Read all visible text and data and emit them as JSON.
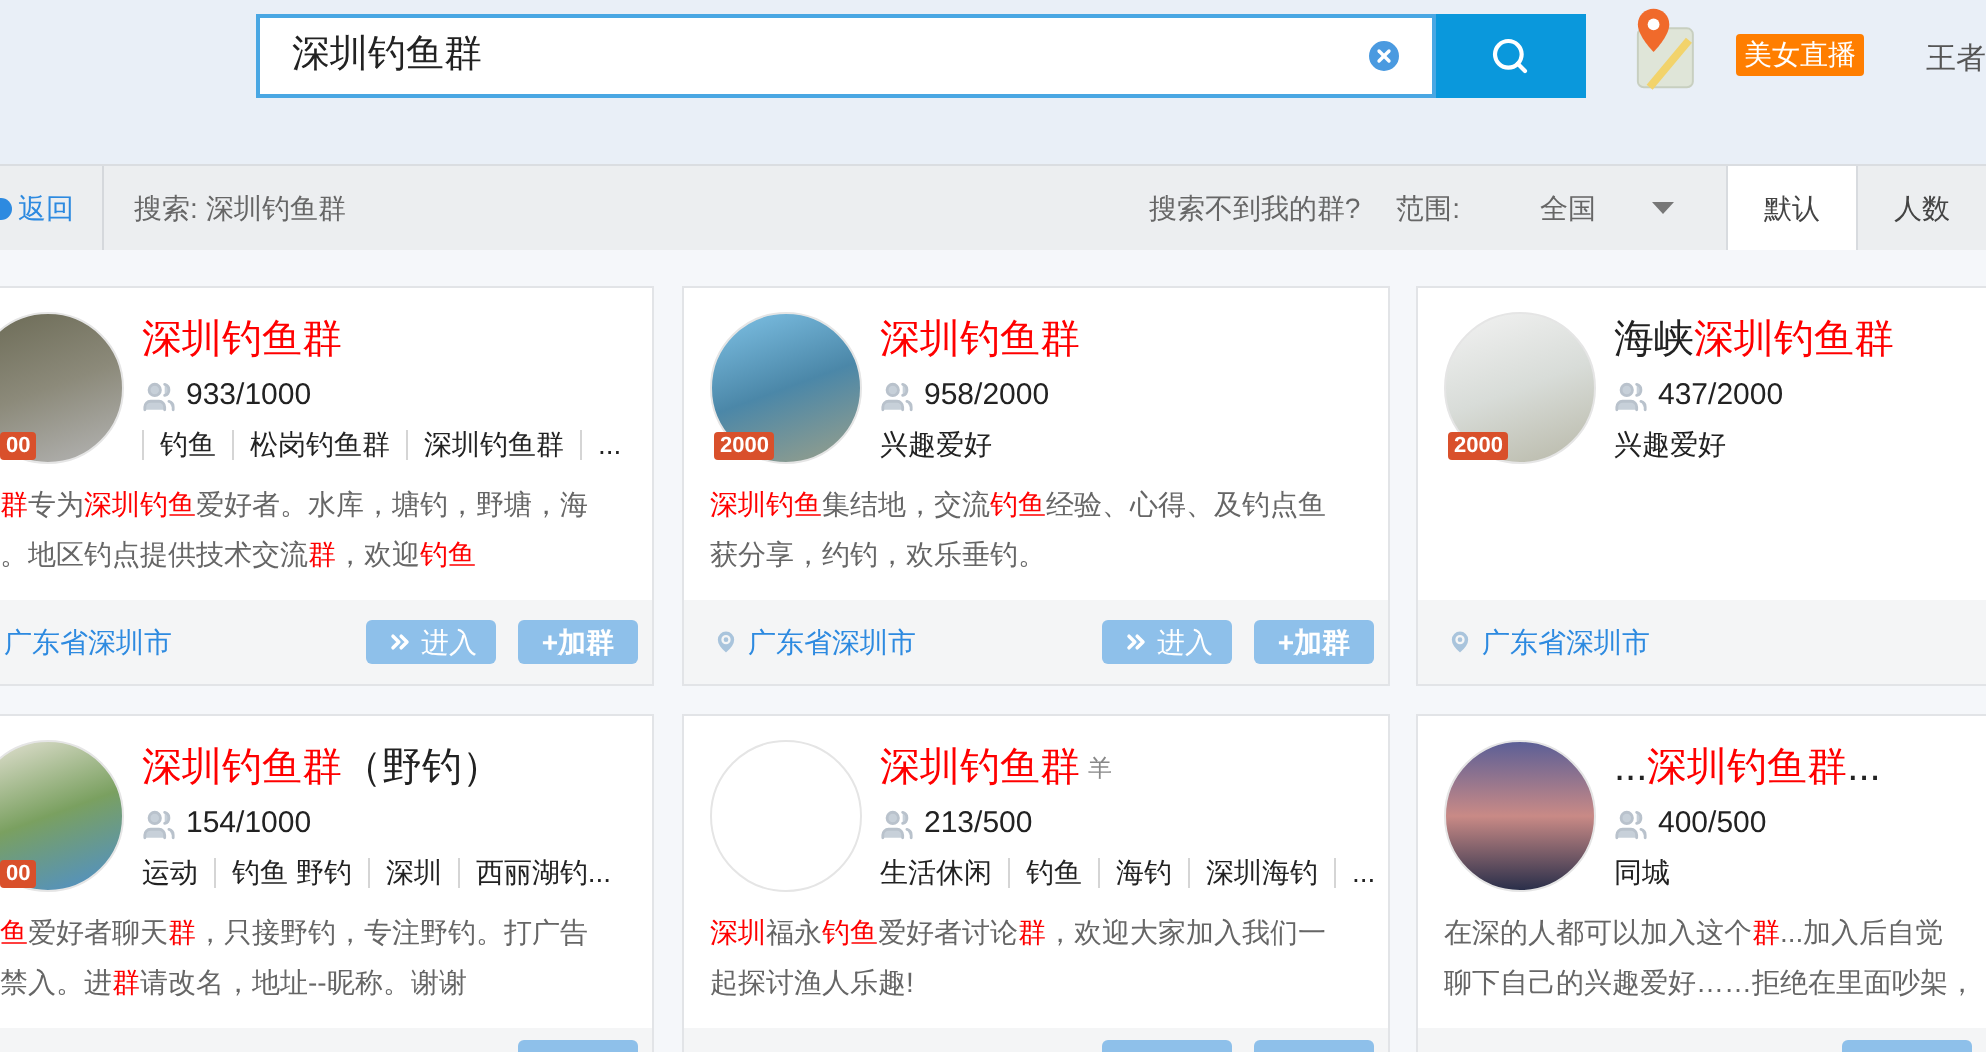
{
  "search": {
    "value": "深圳钓鱼群"
  },
  "header": {
    "live_badge": "美女直播",
    "user": "王者"
  },
  "toolbar": {
    "back": "返回",
    "query": "搜索: 深圳钓鱼群",
    "not_found": "搜索不到我的群?",
    "range_label": "范围:",
    "range_value": "全国",
    "sort_tabs": [
      {
        "label": "默认",
        "selected": true
      },
      {
        "label": "人数",
        "selected": false
      }
    ]
  },
  "cards": [
    {
      "title": [
        {
          "text": "深圳钓鱼群",
          "kind": "highlight"
        }
      ],
      "badge": "00",
      "members": "933/1000",
      "leading_divider": true,
      "tags": [
        "钓鱼",
        "松岗钓鱼群",
        "深圳钓鱼群",
        "..."
      ],
      "description": [
        [
          {
            "text": "群",
            "kind": "highlight"
          },
          {
            "text": "专为",
            "kind": "plain"
          },
          {
            "text": "深圳钓鱼",
            "kind": "highlight"
          },
          {
            "text": "爱好者。水库，塘钓，野塘，海",
            "kind": "plain"
          }
        ],
        [
          {
            "text": "。地区钓点提供技术交流",
            "kind": "plain"
          },
          {
            "text": "群",
            "kind": "highlight"
          },
          {
            "text": "，欢迎",
            "kind": "plain"
          },
          {
            "text": "钓鱼",
            "kind": "highlight"
          }
        ]
      ],
      "location": "广东省深圳市",
      "actions": [
        {
          "kind": "enter",
          "label": "进入"
        },
        {
          "kind": "join",
          "label": "+加群"
        }
      ]
    },
    {
      "title": [
        {
          "text": "深圳钓鱼群",
          "kind": "highlight"
        }
      ],
      "badge": "2000",
      "members": "958/2000",
      "tags": [
        "兴趣爱好"
      ],
      "description": [
        [
          {
            "text": "深圳钓鱼",
            "kind": "highlight"
          },
          {
            "text": "集结地，交流",
            "kind": "plain"
          },
          {
            "text": "钓鱼",
            "kind": "highlight"
          },
          {
            "text": "经验、心得、及钓点鱼",
            "kind": "plain"
          }
        ],
        [
          {
            "text": "获分享，约钓，欢乐垂钓。",
            "kind": "plain"
          }
        ]
      ],
      "location": "广东省深圳市",
      "actions": [
        {
          "kind": "enter",
          "label": "进入"
        },
        {
          "kind": "join",
          "label": "+加群"
        }
      ]
    },
    {
      "title": [
        {
          "text": "海峡",
          "kind": "plain"
        },
        {
          "text": "深圳钓鱼群",
          "kind": "highlight"
        }
      ],
      "badge": "2000",
      "members": "437/2000",
      "tags": [
        "兴趣爱好"
      ],
      "location": "广东省深圳市"
    },
    {
      "title": [
        {
          "text": "深圳钓鱼群",
          "kind": "highlight"
        },
        {
          "text": "（野钓）",
          "kind": "plain"
        }
      ],
      "badge": "00",
      "members": "154/1000",
      "tags": [
        "运动",
        "钓鱼 野钓",
        "深圳",
        "西丽湖钓..."
      ],
      "description": [
        [
          {
            "text": "鱼",
            "kind": "highlight"
          },
          {
            "text": "爱好者聊天",
            "kind": "plain"
          },
          {
            "text": "群",
            "kind": "highlight"
          },
          {
            "text": "，只接野钓，专注野钓。打广告",
            "kind": "plain"
          }
        ],
        [
          {
            "text": "禁入。进",
            "kind": "plain"
          },
          {
            "text": "群",
            "kind": "highlight"
          },
          {
            "text": "请改名，地址--昵称。谢谢",
            "kind": "plain"
          }
        ]
      ],
      "actions": [
        {
          "kind": "join"
        }
      ]
    },
    {
      "title": [
        {
          "text": "深圳钓鱼群",
          "kind": "highlight"
        },
        {
          "text": "羊",
          "kind": "small"
        }
      ],
      "members": "213/500",
      "tags": [
        "生活休闲",
        "钓鱼",
        "海钓",
        "深圳海钓",
        "..."
      ],
      "description": [
        [
          {
            "text": "深圳",
            "kind": "highlight"
          },
          {
            "text": "福永",
            "kind": "plain"
          },
          {
            "text": "钓鱼",
            "kind": "highlight"
          },
          {
            "text": "爱好者讨论",
            "kind": "plain"
          },
          {
            "text": "群",
            "kind": "highlight"
          },
          {
            "text": "，欢迎大家加入我们一",
            "kind": "plain"
          }
        ],
        [
          {
            "text": "起探讨渔人乐趣!",
            "kind": "plain"
          }
        ]
      ],
      "actions": [
        {
          "kind": "enter"
        },
        {
          "kind": "join"
        }
      ]
    },
    {
      "title": [
        {
          "text": "...",
          "kind": "plain"
        },
        {
          "text": "深圳钓鱼群",
          "kind": "highlight"
        },
        {
          "text": "...",
          "kind": "plain"
        }
      ],
      "members": "400/500",
      "tags": [
        "同城"
      ],
      "description": [
        [
          {
            "text": "在深的人都可以加入这个",
            "kind": "plain"
          },
          {
            "text": "群",
            "kind": "highlight"
          },
          {
            "text": "...加入后自觉",
            "kind": "plain"
          }
        ],
        [
          {
            "text": "聊下自己的兴趣爱好……拒绝在里面吵架，",
            "kind": "plain"
          }
        ]
      ],
      "actions": [
        {
          "kind": "enter"
        }
      ]
    }
  ]
}
